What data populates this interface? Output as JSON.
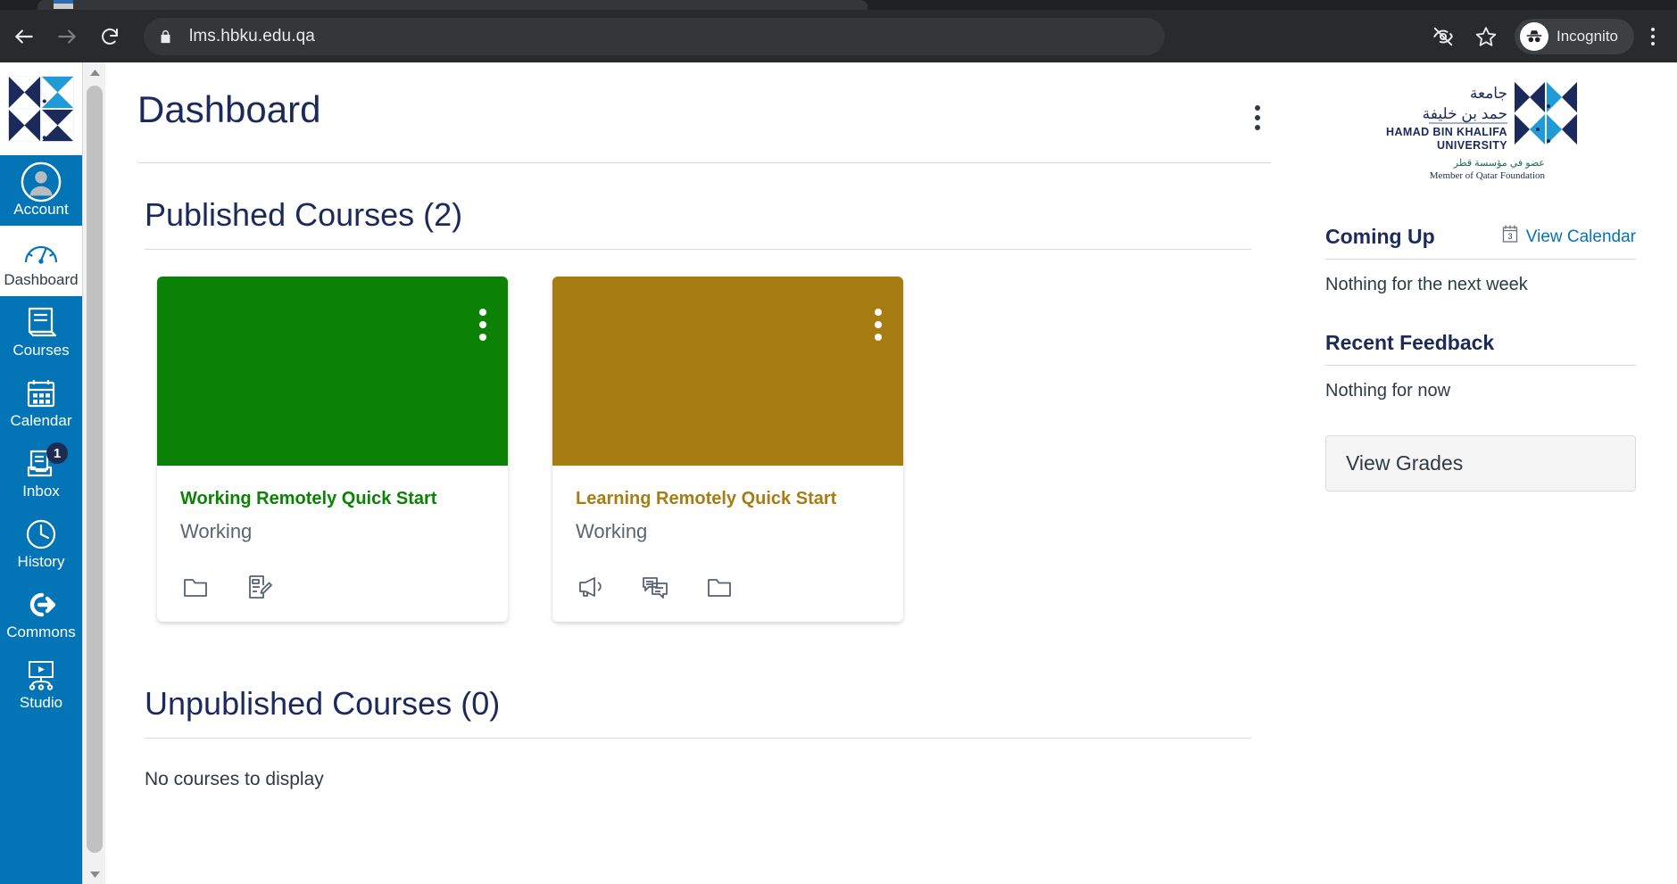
{
  "browser": {
    "url": "lms.hbku.edu.qa",
    "back_label": "Back",
    "forward_label": "Forward",
    "reload_label": "Reload",
    "lock_icon": "lock-icon",
    "eye_off_icon": "eye-off-icon",
    "star_icon": "star-icon",
    "profile_label": "Incognito",
    "menu_icon": "chrome-menu-icon"
  },
  "global_nav": {
    "logo_alt": "Canvas institution logo",
    "items": [
      {
        "label": "Account",
        "icon": "user-avatar-icon",
        "active": true,
        "badge": null
      },
      {
        "label": "Dashboard",
        "icon": "dashboard-gauge-icon",
        "active": false,
        "badge": null
      },
      {
        "label": "Courses",
        "icon": "book-icon",
        "active": true,
        "badge": null
      },
      {
        "label": "Calendar",
        "icon": "calendar-icon",
        "active": true,
        "badge": null
      },
      {
        "label": "Inbox",
        "icon": "inbox-tray-icon",
        "active": true,
        "badge": "1"
      },
      {
        "label": "History",
        "icon": "clock-icon",
        "active": true,
        "badge": null
      },
      {
        "label": "Commons",
        "icon": "commons-arrow-icon",
        "active": true,
        "badge": null
      },
      {
        "label": "Studio",
        "icon": "studio-screen-icon",
        "active": true,
        "badge": null
      }
    ],
    "background_color": "#0374B5"
  },
  "header": {
    "title": "Dashboard",
    "options_icon": "kebab-menu-icon"
  },
  "published": {
    "section_title": "Published Courses (2)",
    "cards": [
      {
        "title": "Working Remotely Quick Start",
        "term": "Working",
        "color": "#0B8205",
        "kebab_icon": "kebab-menu-icon",
        "actions": [
          {
            "icon": "files-folder-icon",
            "label": "Files"
          },
          {
            "icon": "assignments-icon",
            "label": "Assignments"
          }
        ]
      },
      {
        "title": "Learning Remotely Quick Start",
        "term": "Working",
        "color": "#A67C13",
        "kebab_icon": "kebab-menu-icon",
        "actions": [
          {
            "icon": "announcements-megaphone-icon",
            "label": "Announcements"
          },
          {
            "icon": "discussions-icon",
            "label": "Discussions"
          },
          {
            "icon": "files-folder-icon",
            "label": "Files"
          }
        ]
      }
    ]
  },
  "unpublished": {
    "section_title": "Unpublished Courses (0)",
    "empty_text": "No courses to display"
  },
  "right_sidebar": {
    "logo": {
      "arabic_line1": "جامعة",
      "arabic_line2": "حمد بن خليفة",
      "english_line1": "HAMAD BIN KHALIFA",
      "english_line2": "UNIVERSITY",
      "arabic_member": "عضو في مؤسسة قطر",
      "english_member": "Member of Qatar Foundation"
    },
    "coming_up": {
      "title": "Coming Up",
      "link_label": "View Calendar",
      "link_icon": "calendar-icon",
      "calendar_day": "3",
      "empty_text": "Nothing for the next week"
    },
    "recent_feedback": {
      "title": "Recent Feedback",
      "empty_text": "Nothing for now"
    },
    "view_grades_label": "View Grades"
  },
  "colors": {
    "canvas_blue": "#0374B5",
    "heading_navy": "#1b2a5b",
    "card_green": "#0B8205",
    "card_gold": "#A67C13"
  }
}
